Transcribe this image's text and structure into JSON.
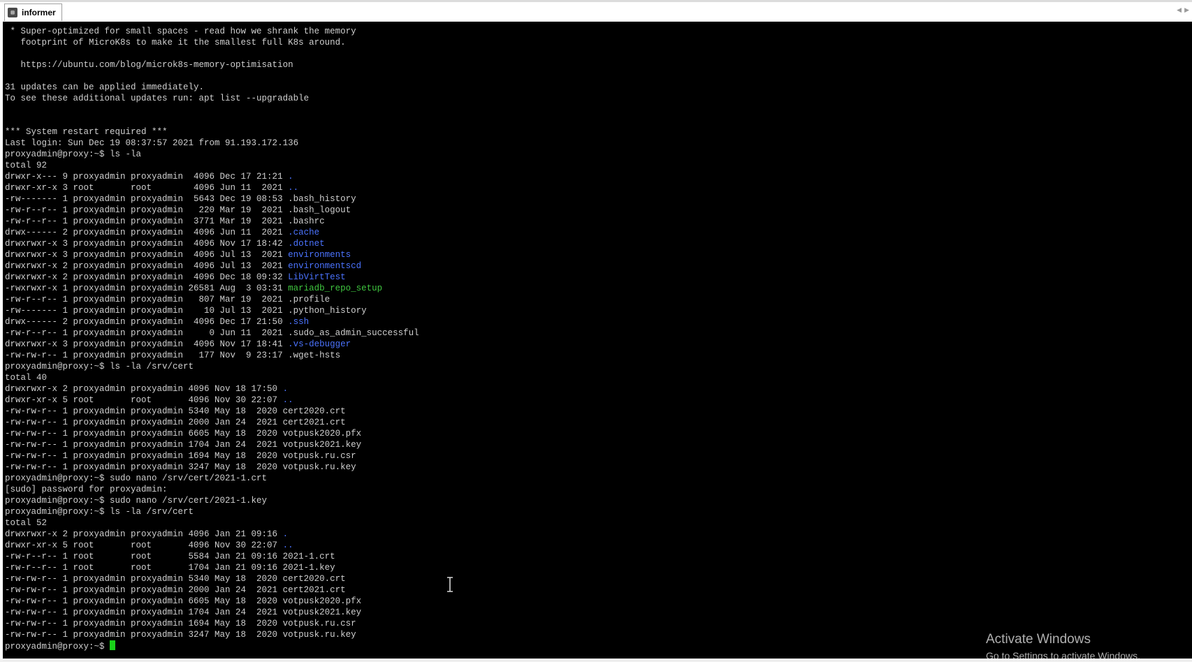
{
  "window": {
    "tab_title": "informer",
    "tab_icon": "terminal-app-icon"
  },
  "terminal": {
    "colors": {
      "background": "#000000",
      "text": "#cfcfcf",
      "directory": "#4b73ff",
      "executable": "#3fc53f",
      "cursor": "#19d219"
    },
    "lines": [
      [
        {
          "t": " * Super-optimized for small spaces - read how we shrank the memory",
          "c": "n"
        }
      ],
      [
        {
          "t": "   footprint of MicroK8s to make it the smallest full K8s around.",
          "c": "n"
        }
      ],
      [
        {
          "t": "",
          "c": "n"
        }
      ],
      [
        {
          "t": "   https://ubuntu.com/blog/microk8s-memory-optimisation",
          "c": "n"
        }
      ],
      [
        {
          "t": "",
          "c": "n"
        }
      ],
      [
        {
          "t": "31 updates can be applied immediately.",
          "c": "n"
        }
      ],
      [
        {
          "t": "To see these additional updates run: apt list --upgradable",
          "c": "n"
        }
      ],
      [
        {
          "t": "",
          "c": "n"
        }
      ],
      [
        {
          "t": "",
          "c": "n"
        }
      ],
      [
        {
          "t": "*** System restart required ***",
          "c": "n"
        }
      ],
      [
        {
          "t": "Last login: Sun Dec 19 08:37:57 2021 from 91.193.172.136",
          "c": "n"
        }
      ],
      [
        {
          "t": "proxyadmin@proxy:~$ ls -la",
          "c": "n"
        }
      ],
      [
        {
          "t": "total 92",
          "c": "n"
        }
      ],
      [
        {
          "t": "drwxr-x--- 9 proxyadmin proxyadmin  4096 Dec 17 21:21 ",
          "c": "n"
        },
        {
          "t": ".",
          "c": "d"
        }
      ],
      [
        {
          "t": "drwxr-xr-x 3 root       root        4096 Jun 11  2021 ",
          "c": "n"
        },
        {
          "t": "..",
          "c": "d"
        }
      ],
      [
        {
          "t": "-rw------- 1 proxyadmin proxyadmin  5643 Dec 19 08:53 .bash_history",
          "c": "n"
        }
      ],
      [
        {
          "t": "-rw-r--r-- 1 proxyadmin proxyadmin   220 Mar 19  2021 .bash_logout",
          "c": "n"
        }
      ],
      [
        {
          "t": "-rw-r--r-- 1 proxyadmin proxyadmin  3771 Mar 19  2021 .bashrc",
          "c": "n"
        }
      ],
      [
        {
          "t": "drwx------ 2 proxyadmin proxyadmin  4096 Jun 11  2021 ",
          "c": "n"
        },
        {
          "t": ".cache",
          "c": "d"
        }
      ],
      [
        {
          "t": "drwxrwxr-x 3 proxyadmin proxyadmin  4096 Nov 17 18:42 ",
          "c": "n"
        },
        {
          "t": ".dotnet",
          "c": "d"
        }
      ],
      [
        {
          "t": "drwxrwxr-x 3 proxyadmin proxyadmin  4096 Jul 13  2021 ",
          "c": "n"
        },
        {
          "t": "environments",
          "c": "d"
        }
      ],
      [
        {
          "t": "drwxrwxr-x 2 proxyadmin proxyadmin  4096 Jul 13  2021 ",
          "c": "n"
        },
        {
          "t": "environmentscd",
          "c": "d"
        }
      ],
      [
        {
          "t": "drwxrwxr-x 2 proxyadmin proxyadmin  4096 Dec 18 09:32 ",
          "c": "n"
        },
        {
          "t": "LibVirtTest",
          "c": "d"
        }
      ],
      [
        {
          "t": "-rwxrwxr-x 1 proxyadmin proxyadmin 26581 Aug  3 03:31 ",
          "c": "n"
        },
        {
          "t": "mariadb_repo_setup",
          "c": "x"
        }
      ],
      [
        {
          "t": "-rw-r--r-- 1 proxyadmin proxyadmin   807 Mar 19  2021 .profile",
          "c": "n"
        }
      ],
      [
        {
          "t": "-rw------- 1 proxyadmin proxyadmin    10 Jul 13  2021 .python_history",
          "c": "n"
        }
      ],
      [
        {
          "t": "drwx------ 2 proxyadmin proxyadmin  4096 Dec 17 21:50 ",
          "c": "n"
        },
        {
          "t": ".ssh",
          "c": "d"
        }
      ],
      [
        {
          "t": "-rw-r--r-- 1 proxyadmin proxyadmin     0 Jun 11  2021 .sudo_as_admin_successful",
          "c": "n"
        }
      ],
      [
        {
          "t": "drwxrwxr-x 3 proxyadmin proxyadmin  4096 Nov 17 18:41 ",
          "c": "n"
        },
        {
          "t": ".vs-debugger",
          "c": "d"
        }
      ],
      [
        {
          "t": "-rw-rw-r-- 1 proxyadmin proxyadmin   177 Nov  9 23:17 .wget-hsts",
          "c": "n"
        }
      ],
      [
        {
          "t": "proxyadmin@proxy:~$ ls -la /srv/cert",
          "c": "n"
        }
      ],
      [
        {
          "t": "total 40",
          "c": "n"
        }
      ],
      [
        {
          "t": "drwxrwxr-x 2 proxyadmin proxyadmin 4096 Nov 18 17:50 ",
          "c": "n"
        },
        {
          "t": ".",
          "c": "d"
        }
      ],
      [
        {
          "t": "drwxr-xr-x 5 root       root       4096 Nov 30 22:07 ",
          "c": "n"
        },
        {
          "t": "..",
          "c": "d"
        }
      ],
      [
        {
          "t": "-rw-rw-r-- 1 proxyadmin proxyadmin 5340 May 18  2020 cert2020.crt",
          "c": "n"
        }
      ],
      [
        {
          "t": "-rw-rw-r-- 1 proxyadmin proxyadmin 2000 Jan 24  2021 cert2021.crt",
          "c": "n"
        }
      ],
      [
        {
          "t": "-rw-rw-r-- 1 proxyadmin proxyadmin 6605 May 18  2020 votpusk2020.pfx",
          "c": "n"
        }
      ],
      [
        {
          "t": "-rw-rw-r-- 1 proxyadmin proxyadmin 1704 Jan 24  2021 votpusk2021.key",
          "c": "n"
        }
      ],
      [
        {
          "t": "-rw-rw-r-- 1 proxyadmin proxyadmin 1694 May 18  2020 votpusk.ru.csr",
          "c": "n"
        }
      ],
      [
        {
          "t": "-rw-rw-r-- 1 proxyadmin proxyadmin 3247 May 18  2020 votpusk.ru.key",
          "c": "n"
        }
      ],
      [
        {
          "t": "proxyadmin@proxy:~$ sudo nano /srv/cert/2021-1.crt",
          "c": "n"
        }
      ],
      [
        {
          "t": "[sudo] password for proxyadmin:",
          "c": "n"
        }
      ],
      [
        {
          "t": "proxyadmin@proxy:~$ sudo nano /srv/cert/2021-1.key",
          "c": "n"
        }
      ],
      [
        {
          "t": "proxyadmin@proxy:~$ ls -la /srv/cert",
          "c": "n"
        }
      ],
      [
        {
          "t": "total 52",
          "c": "n"
        }
      ],
      [
        {
          "t": "drwxrwxr-x 2 proxyadmin proxyadmin 4096 Jan 21 09:16 ",
          "c": "n"
        },
        {
          "t": ".",
          "c": "d"
        }
      ],
      [
        {
          "t": "drwxr-xr-x 5 root       root       4096 Nov 30 22:07 ",
          "c": "n"
        },
        {
          "t": "..",
          "c": "d"
        }
      ],
      [
        {
          "t": "-rw-r--r-- 1 root       root       5584 Jan 21 09:16 2021-1.crt",
          "c": "n"
        }
      ],
      [
        {
          "t": "-rw-r--r-- 1 root       root       1704 Jan 21 09:16 2021-1.key",
          "c": "n"
        }
      ],
      [
        {
          "t": "-rw-rw-r-- 1 proxyadmin proxyadmin 5340 May 18  2020 cert2020.crt",
          "c": "n"
        }
      ],
      [
        {
          "t": "-rw-rw-r-- 1 proxyadmin proxyadmin 2000 Jan 24  2021 cert2021.crt",
          "c": "n"
        }
      ],
      [
        {
          "t": "-rw-rw-r-- 1 proxyadmin proxyadmin 6605 May 18  2020 votpusk2020.pfx",
          "c": "n"
        }
      ],
      [
        {
          "t": "-rw-rw-r-- 1 proxyadmin proxyadmin 1704 Jan 24  2021 votpusk2021.key",
          "c": "n"
        }
      ],
      [
        {
          "t": "-rw-rw-r-- 1 proxyadmin proxyadmin 1694 May 18  2020 votpusk.ru.csr",
          "c": "n"
        }
      ],
      [
        {
          "t": "-rw-rw-r-- 1 proxyadmin proxyadmin 3247 May 18  2020 votpusk.ru.key",
          "c": "n"
        }
      ]
    ],
    "prompt": "proxyadmin@proxy:~$ "
  },
  "watermark": {
    "title": "Activate Windows",
    "subtitle": "Go to Settings to activate Windows."
  }
}
